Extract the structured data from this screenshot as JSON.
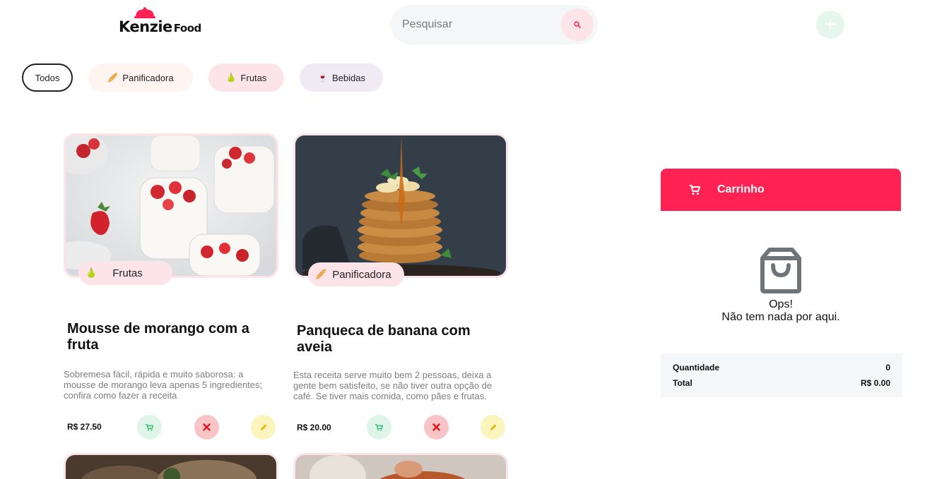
{
  "header": {
    "logo_main": "Kenzie",
    "logo_sub": "Food",
    "search_placeholder": "Pesquisar",
    "search_icon": "search-icon",
    "add_icon": "plus-icon"
  },
  "filters": [
    {
      "label": "Todos",
      "emoji": ""
    },
    {
      "label": "Panificadora",
      "emoji": "🥖"
    },
    {
      "label": "Frutas",
      "emoji": "🍐"
    },
    {
      "label": "Bebidas",
      "emoji": "🍷"
    }
  ],
  "products": [
    {
      "category": "Frutas",
      "category_emoji": "🍐",
      "title": "Mousse de morango com a fruta",
      "description": "Sobremesa fácil, rápida e muito saborosa: a mousse de morango leva apenas 5 ingredientes; confira como fazer a receita",
      "price": "R$ 27.50",
      "image": "strawberry-mousse-photo"
    },
    {
      "category": "Panificadora",
      "category_emoji": "🥖",
      "title": "Panqueca de banana com aveia",
      "description": "Esta receita serve muito bem 2 pessoas, deixa a gente bem satisfeito, se não tiver outra opção de café. Se tiver mais comida, como pães e frutas.",
      "price": "R$ 20.00",
      "image": "banana-pancake-photo"
    }
  ],
  "cart": {
    "title": "Carrinho",
    "empty_title": "Ops!",
    "empty_subtitle": "Não tem nada por aqui.",
    "quantity_label": "Quantidade",
    "quantity_value": "0",
    "total_label": "Total",
    "total_value": "R$ 0.00"
  },
  "colors": {
    "accent": "#ff2253",
    "pink_light": "#fde4e8",
    "green_light": "#e0f5ea",
    "red_light": "#f9c4c6",
    "yellow_light": "#fbf4bd",
    "summary_bg": "#f5f6f8"
  }
}
